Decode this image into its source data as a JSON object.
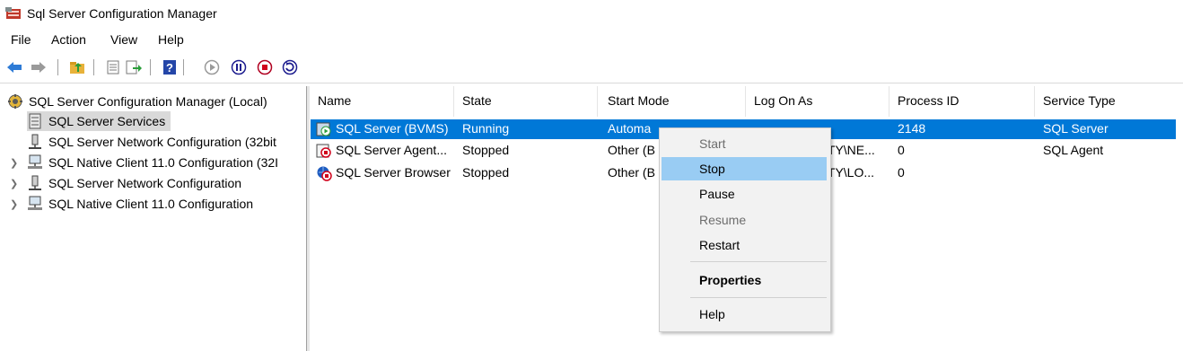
{
  "window": {
    "title": "Sql Server Configuration Manager"
  },
  "menu": [
    "File",
    "Action",
    "View",
    "Help"
  ],
  "toolbar": {
    "buttons": [
      "back-icon",
      "forward-icon",
      "up-folder-icon",
      "properties-sheet-icon",
      "export-list-icon",
      "help-icon",
      "start-service-icon",
      "pause-service-icon",
      "stop-service-icon",
      "restart-service-icon"
    ]
  },
  "tree": {
    "root": "SQL Server Configuration Manager (Local)",
    "items": [
      {
        "label": "SQL Server Services",
        "expandable": false,
        "selected": true
      },
      {
        "label": "SQL Server Network Configuration (32bit",
        "expandable": false
      },
      {
        "label": "SQL Native Client 11.0 Configuration (32I",
        "expandable": true
      },
      {
        "label": "SQL Server Network Configuration",
        "expandable": true
      },
      {
        "label": "SQL Native Client 11.0 Configuration",
        "expandable": true
      }
    ]
  },
  "list": {
    "columns": [
      "Name",
      "State",
      "Start Mode",
      "Log On As",
      "Process ID",
      "Service Type"
    ],
    "rows": [
      {
        "name": "SQL Server (BVMS)",
        "state": "Running",
        "start_mode": "Automa",
        "log_on_as": "",
        "process_id": "2148",
        "service_type": "SQL Server",
        "selected": true
      },
      {
        "name": "SQL Server Agent...",
        "state": "Stopped",
        "start_mode": "Other (B",
        "log_on_as": "ITY\\NE...",
        "process_id": "0",
        "service_type": "SQL Agent"
      },
      {
        "name": "SQL Server Browser",
        "state": "Stopped",
        "start_mode": "Other (B",
        "log_on_as": "ITY\\LO...",
        "process_id": "0",
        "service_type": ""
      }
    ]
  },
  "context_menu": {
    "items": [
      {
        "label": "Start",
        "disabled": true
      },
      {
        "label": "Stop",
        "highlighted": true
      },
      {
        "label": "Pause"
      },
      {
        "label": "Resume",
        "disabled": true
      },
      {
        "label": "Restart"
      },
      {
        "label": "Properties",
        "bold": true
      },
      {
        "label": "Help"
      }
    ]
  },
  "colors": {
    "selection": "#0078d7",
    "menu_hover": "#99ccf3",
    "disabled_text": "#6d6d6d"
  }
}
